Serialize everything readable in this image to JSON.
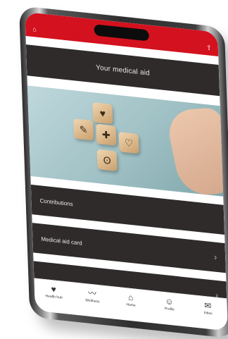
{
  "screen": {
    "title": "Your medical aid"
  },
  "menu": {
    "items": [
      {
        "label": "Contributions",
        "chevron": ""
      },
      {
        "label": "Medical aid card",
        "chevron": "›"
      },
      {
        "label": "",
        "chevron": "›"
      }
    ]
  },
  "tabs": [
    {
      "label": "Health hub",
      "icon": "heart-icon"
    },
    {
      "label": "Wellness",
      "icon": "pulse-icon"
    },
    {
      "label": "Home",
      "icon": "home-icon"
    },
    {
      "label": "Profile",
      "icon": "profile-icon"
    },
    {
      "label": "Inbox",
      "icon": "mail-icon"
    }
  ],
  "colors": {
    "brand_red": "#d4111e",
    "bar_dark": "#2f2b2b"
  }
}
